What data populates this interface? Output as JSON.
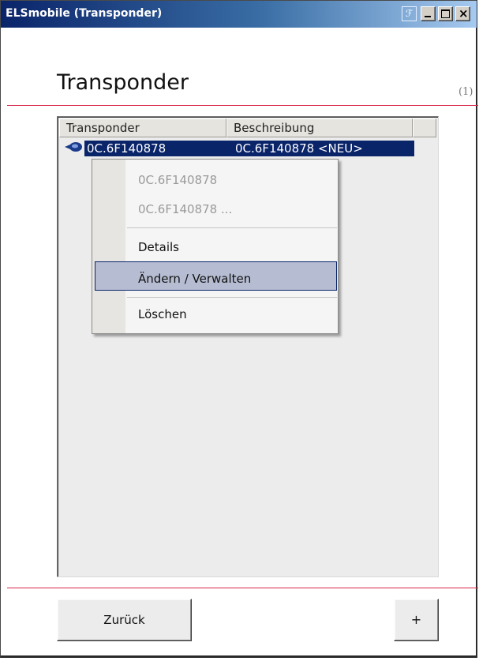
{
  "window": {
    "title": "ELSmobile (Transponder)",
    "title_icon_glyph": "ℱ"
  },
  "page": {
    "title": "Transponder",
    "count": "(1)"
  },
  "list": {
    "columns": [
      "Transponder",
      "Beschreibung"
    ],
    "rows": [
      {
        "icon": "transponder-key-icon",
        "transponder": "0C.6F140878",
        "beschreibung": "0C.6F140878 <NEU>",
        "selected": true
      }
    ]
  },
  "context_menu": {
    "items": [
      {
        "label": "0C.6F140878",
        "enabled": false
      },
      {
        "label": "0C.6F140878    ...",
        "enabled": false
      },
      {
        "label": "Details",
        "enabled": true
      },
      {
        "label": "Ändern / Verwalten",
        "enabled": true,
        "highlighted": true
      },
      {
        "label": "Löschen",
        "enabled": true
      }
    ]
  },
  "buttons": {
    "back_label": "Zurück",
    "add_label": "+"
  },
  "colors": {
    "accent_rule": "#d9264a",
    "selection": "#0a246a",
    "menu_highlight": "#b6bdd2"
  }
}
